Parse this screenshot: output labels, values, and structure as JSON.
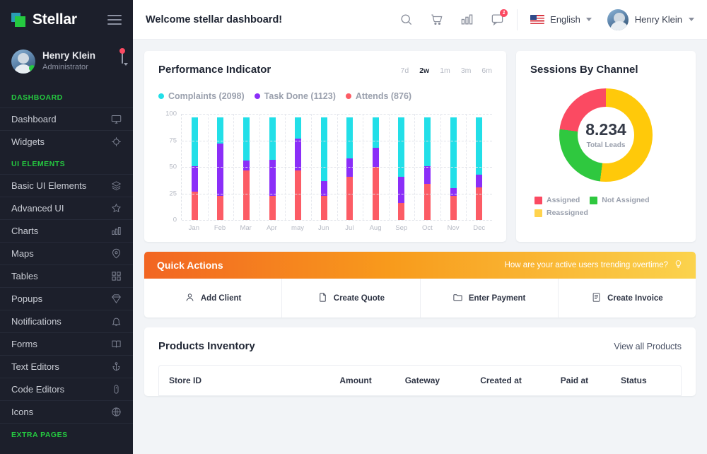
{
  "sidebar": {
    "brand": "Stellar",
    "profile": {
      "name": "Henry Klein",
      "role": "Administrator"
    },
    "sections": [
      {
        "label": "DASHBOARD",
        "items": [
          {
            "label": "Dashboard",
            "icon": "monitor-icon"
          },
          {
            "label": "Widgets",
            "icon": "crosshair-icon"
          }
        ]
      },
      {
        "label": "UI ELEMENTS",
        "items": [
          {
            "label": "Basic UI Elements",
            "icon": "layers-icon"
          },
          {
            "label": "Advanced UI",
            "icon": "star-icon"
          },
          {
            "label": "Charts",
            "icon": "bar-chart-icon"
          },
          {
            "label": "Maps",
            "icon": "map-pin-icon"
          },
          {
            "label": "Tables",
            "icon": "grid-icon"
          },
          {
            "label": "Popups",
            "icon": "diamond-icon"
          },
          {
            "label": "Notifications",
            "icon": "bell-icon"
          },
          {
            "label": "Forms",
            "icon": "book-icon"
          },
          {
            "label": "Text Editors",
            "icon": "anchor-icon"
          },
          {
            "label": "Code Editors",
            "icon": "mouse-icon"
          },
          {
            "label": "Icons",
            "icon": "globe-icon"
          }
        ]
      },
      {
        "label": "EXTRA PAGES",
        "items": []
      }
    ]
  },
  "topbar": {
    "welcome": "Welcome stellar dashboard!",
    "icons": [
      "search-icon",
      "cart-icon",
      "bar-chart-icon",
      "message-icon"
    ],
    "message_badge": "1",
    "language": "English",
    "user": "Henry Klein"
  },
  "performance": {
    "title": "Performance Indicator",
    "ranges": [
      {
        "label": "7d",
        "active": false
      },
      {
        "label": "2w",
        "active": true
      },
      {
        "label": "1m",
        "active": false
      },
      {
        "label": "3m",
        "active": false
      },
      {
        "label": "6m",
        "active": false
      }
    ],
    "legend": [
      {
        "label": "Complaints (2098)",
        "color": "#22dfe8"
      },
      {
        "label": "Task Done (1123)",
        "color": "#8b2ef8"
      },
      {
        "label": "Attends (876)",
        "color": "#fc5c65"
      }
    ]
  },
  "sessions": {
    "title": "Sessions By Channel",
    "total": "8.234",
    "total_label": "Total Leads",
    "legend": [
      {
        "label": "Assigned",
        "color": "#fb4a62"
      },
      {
        "label": "Not Assigned",
        "color": "#2fc83f"
      },
      {
        "label": "Reassigned",
        "color": "#ffc90a"
      }
    ]
  },
  "quick_actions": {
    "title": "Quick Actions",
    "note": "How are your active users trending overtime?",
    "note_icon": "lightbulb-icon",
    "items": [
      {
        "label": "Add Client",
        "icon": "user-icon"
      },
      {
        "label": "Create Quote",
        "icon": "file-icon"
      },
      {
        "label": "Enter Payment",
        "icon": "folder-icon"
      },
      {
        "label": "Create Invoice",
        "icon": "invoice-icon"
      }
    ]
  },
  "products": {
    "title": "Products Inventory",
    "view_all": "View all Products",
    "columns": [
      "Store ID",
      "Amount",
      "Gateway",
      "Created at",
      "Paid at",
      "Status"
    ]
  },
  "chart_data": [
    {
      "type": "bar",
      "title": "Performance Indicator",
      "stacked": true,
      "xlabel": "",
      "ylabel": "",
      "ylim": [
        0,
        100
      ],
      "yticks": [
        0,
        25,
        50,
        75,
        100
      ],
      "grid": true,
      "legend_position": "top-left",
      "categories": [
        "Jan",
        "Feb",
        "Mar",
        "Apr",
        "may",
        "Jun",
        "Jul",
        "Aug",
        "Sep",
        "Oct",
        "Nov",
        "Dec"
      ],
      "series": [
        {
          "name": "Attends (876)",
          "color": "#fc5c65",
          "values": [
            27,
            23,
            47,
            23,
            47,
            23,
            41,
            50,
            16,
            34,
            23,
            31
          ]
        },
        {
          "name": "Task Done (1123)",
          "color": "#8b2ef8",
          "values": [
            24,
            49,
            9,
            34,
            30,
            14,
            17,
            18,
            25,
            17,
            7,
            12
          ]
        },
        {
          "name": "Complaints (2098)",
          "color": "#22dfe8",
          "values": [
            46,
            25,
            41,
            40,
            20,
            60,
            39,
            29,
            56,
            46,
            67,
            54
          ]
        }
      ]
    },
    {
      "type": "pie",
      "title": "Sessions By Channel",
      "donut": true,
      "center_value": "8.234",
      "center_label": "Total Leads",
      "legend_position": "bottom",
      "labels": [
        "Reassigned",
        "Not Assigned",
        "Assigned"
      ],
      "colors": [
        "#ffc90a",
        "#2fc83f",
        "#fb4a62"
      ],
      "values": [
        52,
        25,
        23
      ]
    }
  ]
}
